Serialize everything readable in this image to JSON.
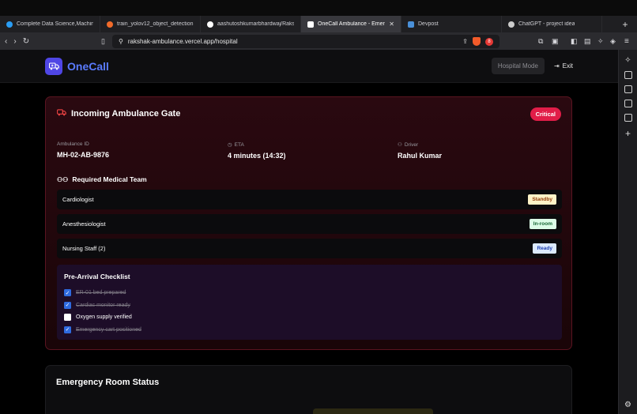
{
  "browser": {
    "tabs": [
      {
        "label": "Complete Data Science,Machine",
        "color": "#2a9df4"
      },
      {
        "label": "train_yolov12_object_detection",
        "color": "#f26b2a"
      },
      {
        "label": "aashutoshkumarbhardwaj/Raksh",
        "color": "#ffffff"
      },
      {
        "label": "OneCall Ambulance - Emer",
        "color": "#ffffff",
        "active": true
      },
      {
        "label": "Devpost",
        "color": "#4a90d9"
      },
      {
        "label": "ChatGPT - project idea",
        "color": "#cccccc"
      }
    ],
    "url": "rakshak-ambulance.vercel.app/hospital",
    "notification_count": "8"
  },
  "header": {
    "brand": "OneCall",
    "hospital_mode": "Hospital Mode",
    "exit": "Exit"
  },
  "alert": {
    "title": "Incoming Ambulance Gate",
    "severity": "Critical",
    "ambulance_id_label": "Ambulance ID",
    "ambulance_id": "MH-02-AB-9876",
    "eta_label": "ETA",
    "eta": "4 minutes (14:32)",
    "driver_label": "Driver",
    "driver": "Rahul Kumar",
    "team_title": "Required Medical Team",
    "team": [
      {
        "role": "Cardiologist",
        "status": "Standby",
        "bg": "#fef3c7",
        "fg": "#92400e"
      },
      {
        "role": "Anesthesiologist",
        "status": "In-room",
        "bg": "#dcfce7",
        "fg": "#166534"
      },
      {
        "role": "Nursing Staff (2)",
        "status": "Ready",
        "bg": "#dbeafe",
        "fg": "#1e40af"
      }
    ],
    "checklist_title": "Pre-Arrival Checklist",
    "checklist": [
      {
        "text": "ER-01 bed prepared",
        "checked": true
      },
      {
        "text": "Cardiac monitor ready",
        "checked": true
      },
      {
        "text": "Oxygen supply verified",
        "checked": false
      },
      {
        "text": "Emergency cart positioned",
        "checked": true
      }
    ]
  },
  "er_status": {
    "title": "Emergency Room Status"
  }
}
